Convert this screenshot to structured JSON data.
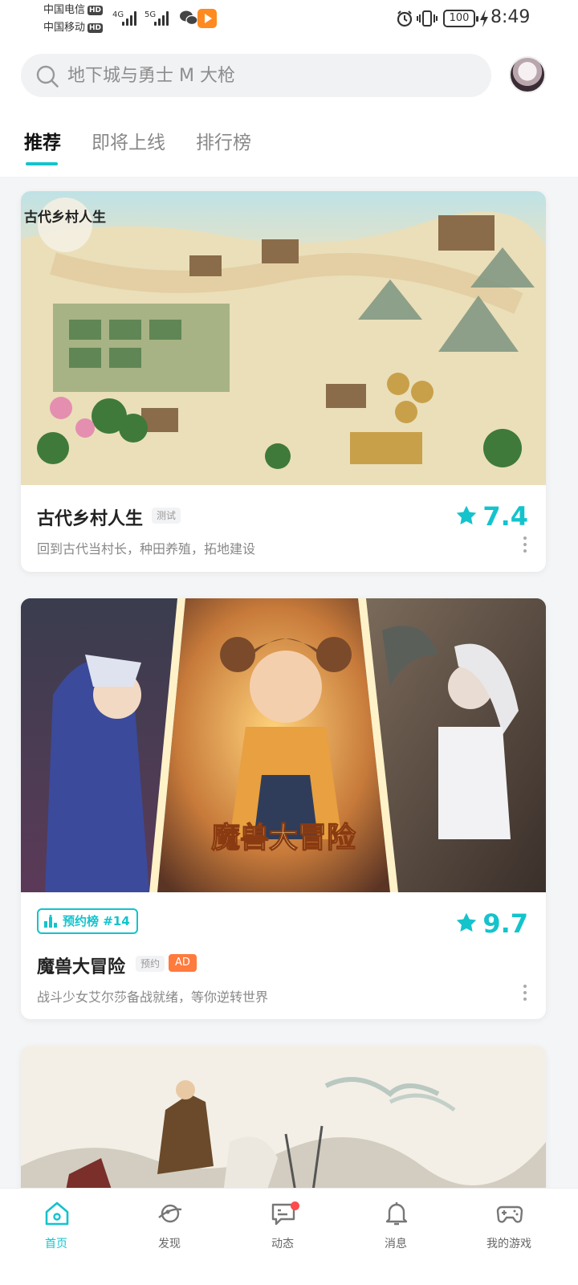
{
  "status_bar": {
    "carrier_1": "中国电信",
    "carrier_2": "中国移动",
    "hd_label": "HD",
    "net_1": "4G",
    "net_2": "5G",
    "battery": "100",
    "time": "8:49",
    "icons": [
      "signal-icon",
      "wechat-icon",
      "video-app-icon",
      "alarm-icon",
      "vibrate-icon",
      "battery-icon",
      "charging-icon"
    ]
  },
  "search": {
    "placeholder": "地下城与勇士 M 大枪"
  },
  "tabs": [
    {
      "label": "推荐",
      "active": true
    },
    {
      "label": "即将上线",
      "active": false
    },
    {
      "label": "排行榜",
      "active": false
    }
  ],
  "cards": [
    {
      "title": "古代乡村人生",
      "tag": "测试",
      "description": "回到古代当村长，种田养殖，拓地建设",
      "score": "7.4",
      "logo_text": "古代乡村人生"
    },
    {
      "rank_badge": "预约榜 #14",
      "title": "魔兽大冒险",
      "tag": "预约",
      "ad_label": "AD",
      "description": "战斗少女艾尔莎备战就绪，等你逆转世界",
      "score": "9.7",
      "logo_text": "魔兽大冒险"
    },
    {
      "title": "",
      "description": ""
    }
  ],
  "bottom_nav": [
    {
      "label": "首页",
      "icon": "home-icon",
      "active": true
    },
    {
      "label": "发现",
      "icon": "discover-icon",
      "active": false
    },
    {
      "label": "动态",
      "icon": "message-bubble-icon",
      "active": false,
      "badge": true
    },
    {
      "label": "消息",
      "icon": "bell-icon",
      "active": false
    },
    {
      "label": "我的游戏",
      "icon": "gamepad-icon",
      "active": false
    }
  ],
  "colors": {
    "accent": "#14c3cc",
    "ad": "#ff7a3d",
    "badge_dot": "#ff4b4b"
  }
}
